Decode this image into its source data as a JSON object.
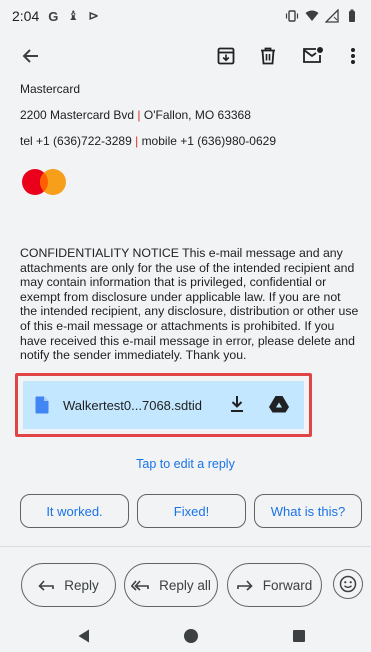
{
  "status_bar": {
    "time": "2:04",
    "glyphs": [
      "G",
      "♝",
      "⊳"
    ]
  },
  "toolbar": {
    "icons": [
      "back-arrow-icon",
      "archive-icon",
      "delete-icon",
      "mark-unread-icon",
      "more-vert-icon"
    ]
  },
  "signature": {
    "company": "Mastercard",
    "address": "2200 Mastercard Bvd",
    "address_sep": "|",
    "city": "O'Fallon, MO 63368",
    "tel": "tel +1 (636)722-3289",
    "tel_sep": "|",
    "mobile": "mobile +1 (636)980-0629"
  },
  "notice": "CONFIDENTIALITY NOTICE This e-mail message and any attachments are only for the use of the intended recipient and may contain information that is privileged, confidential or exempt from disclosure under applicable law. If you are not the intended recipient, any disclosure, distribution or other use of this e-mail message or attachments is prohibited. If you have received this e-mail message in error, please delete and notify the sender immediately. Thank you.",
  "attachment": {
    "name": "Walkertest0...7068.sdtid"
  },
  "tap_to_edit": "Tap to edit a reply",
  "smart_replies": [
    "It worked.",
    "Fixed!",
    "What is this?"
  ],
  "actions": {
    "reply": "Reply",
    "reply_all": "Reply all",
    "forward": "Forward"
  },
  "colors": {
    "accent": "#1a73e8",
    "attachment_bg": "#c2e7ff",
    "highlight_border": "#e04446",
    "mc_red": "#eb001b",
    "mc_orange": "#f79e1b"
  }
}
